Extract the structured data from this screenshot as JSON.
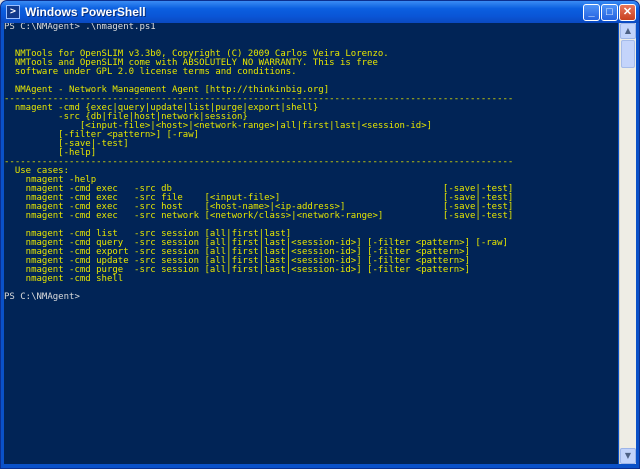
{
  "window": {
    "title": "Windows PowerShell",
    "app_icon": "powershell-icon",
    "icon_glyph": ">",
    "buttons": {
      "minimize": "_",
      "maximize": "□",
      "close": "✕"
    },
    "scroll_up": "▲",
    "scroll_down": "▼"
  },
  "colors": {
    "console_bg": "#012456",
    "prompt_text": "#dcdcdc",
    "output_text": "#e6e600",
    "titlebar": "#0a55d6"
  },
  "console": {
    "lines": [
      {
        "text": "PS C:\\NMAgent> .\\nmagent.ps1",
        "color": "white"
      },
      {
        "text": "",
        "color": "yellow"
      },
      {
        "text": "",
        "color": "yellow"
      },
      {
        "text": "  NMTools for OpenSLIM v3.3b0, Copyright (C) 2009 Carlos Veira Lorenzo.",
        "color": "yellow"
      },
      {
        "text": "  NMTools and OpenSLIM come with ABSOLUTELY NO WARRANTY. This is free",
        "color": "yellow"
      },
      {
        "text": "  software under GPL 2.0 license terms and conditions.",
        "color": "yellow"
      },
      {
        "text": "",
        "color": "yellow"
      },
      {
        "text": "  NMAgent - Network Management Agent [http://thinkinbig.org]",
        "color": "yellow"
      },
      {
        "text": "----------------------------------------------------------------------------------------------",
        "color": "yellow"
      },
      {
        "text": "  nmagent -cmd {exec|query|update|list|purge|export|shell}",
        "color": "yellow"
      },
      {
        "text": "          -src {db|file|host|network|session}",
        "color": "yellow"
      },
      {
        "text": "              [<input-file>|<host>|<network-range>|all|first|last|<session-id>]",
        "color": "yellow"
      },
      {
        "text": "          [-filter <pattern>] [-raw]",
        "color": "yellow"
      },
      {
        "text": "          [-save|-test]",
        "color": "yellow"
      },
      {
        "text": "          [-help]",
        "color": "yellow"
      },
      {
        "text": "----------------------------------------------------------------------------------------------",
        "color": "yellow"
      },
      {
        "text": "  Use cases:",
        "color": "yellow"
      },
      {
        "text": "    nmagent -help",
        "color": "yellow"
      },
      {
        "text": "    nmagent -cmd exec   -src db                                                  [-save|-test]",
        "color": "yellow"
      },
      {
        "text": "    nmagent -cmd exec   -src file    [<input-file>]                              [-save|-test]",
        "color": "yellow"
      },
      {
        "text": "    nmagent -cmd exec   -src host    [<host-name>|<ip-address>]                  [-save|-test]",
        "color": "yellow"
      },
      {
        "text": "    nmagent -cmd exec   -src network [<network/class>|<network-range>]           [-save|-test]",
        "color": "yellow"
      },
      {
        "text": "",
        "color": "yellow"
      },
      {
        "text": "    nmagent -cmd list   -src session [all|first|last]",
        "color": "yellow"
      },
      {
        "text": "    nmagent -cmd query  -src session [all|first|last|<session-id>] [-filter <pattern>] [-raw]",
        "color": "yellow"
      },
      {
        "text": "    nmagent -cmd export -src session [all|first|last|<session-id>] [-filter <pattern>]",
        "color": "yellow"
      },
      {
        "text": "    nmagent -cmd update -src session [all|first|last|<session-id>] [-filter <pattern>]",
        "color": "yellow"
      },
      {
        "text": "    nmagent -cmd purge  -src session [all|first|last|<session-id>] [-filter <pattern>]",
        "color": "yellow"
      },
      {
        "text": "    nmagent -cmd shell",
        "color": "yellow"
      },
      {
        "text": "",
        "color": "yellow"
      },
      {
        "text": "PS C:\\NMAgent>",
        "color": "white"
      }
    ]
  }
}
